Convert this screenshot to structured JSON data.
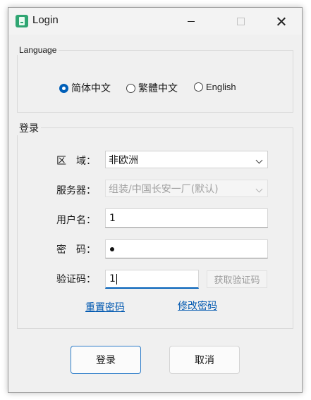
{
  "window": {
    "title": "Login"
  },
  "language": {
    "group_label": "Language",
    "options": [
      {
        "label": "简体中文",
        "checked": true
      },
      {
        "label": "繁體中文",
        "checked": false
      },
      {
        "label": "English",
        "checked": false
      }
    ]
  },
  "login": {
    "group_label": "登录",
    "region_label": "区　域：",
    "region_value": "非欧洲",
    "server_label": "服务器：",
    "server_value": "组装/中国长安一厂(默认)",
    "username_label": "用户名：",
    "username_value": "1",
    "password_label": "密　码：",
    "captcha_label": "验证码：",
    "captcha_value": "1",
    "get_captcha": "获取验证码",
    "reset_password": "重置密码",
    "change_password": "修改密码"
  },
  "buttons": {
    "login": "登录",
    "cancel": "取消"
  },
  "colors": {
    "accent": "#005fb8",
    "link": "#0058b0"
  }
}
